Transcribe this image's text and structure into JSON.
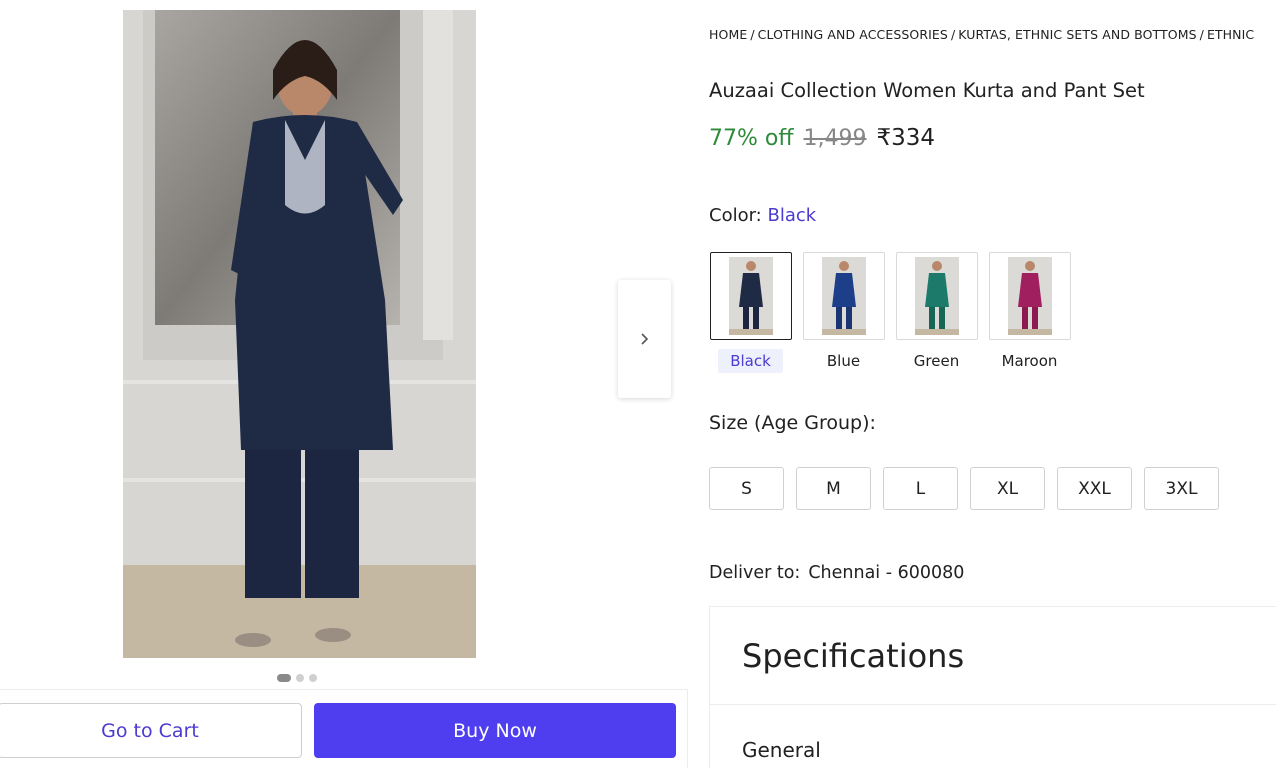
{
  "breadcrumb": {
    "items": [
      "HOME",
      "CLOTHING AND ACCESSORIES",
      "KURTAS, ETHNIC SETS AND BOTTOMS",
      "ETHNIC"
    ],
    "separator": "/"
  },
  "product": {
    "title": "Auzaai Collection Women Kurta and Pant Set",
    "discount": "77% off",
    "mrp": "1,499",
    "price": "₹334"
  },
  "color": {
    "label": "Color:",
    "selected": "Black",
    "options": [
      {
        "label": "Black",
        "hex": "#1f2a44"
      },
      {
        "label": "Blue",
        "hex": "#1d3f8a"
      },
      {
        "label": "Green",
        "hex": "#1c7a6a"
      },
      {
        "label": "Maroon",
        "hex": "#a01f5e"
      }
    ]
  },
  "size": {
    "label": "Size (Age Group):",
    "options": [
      "S",
      "M",
      "L",
      "XL",
      "XXL",
      "3XL"
    ]
  },
  "delivery": {
    "label": "Deliver to:",
    "location": "Chennai - 600080"
  },
  "specifications": {
    "title": "Specifications",
    "section": "General"
  },
  "gallery": {
    "dot_count": 3,
    "active_dot": 1,
    "next_icon": "chevron-right-icon"
  },
  "actions": {
    "cart_label": "Go to Cart",
    "buy_label": "Buy Now"
  },
  "colors": {
    "accent": "#4e3ef0",
    "discount_green": "#2e8b3a",
    "link_purple": "#4b3bd1"
  }
}
